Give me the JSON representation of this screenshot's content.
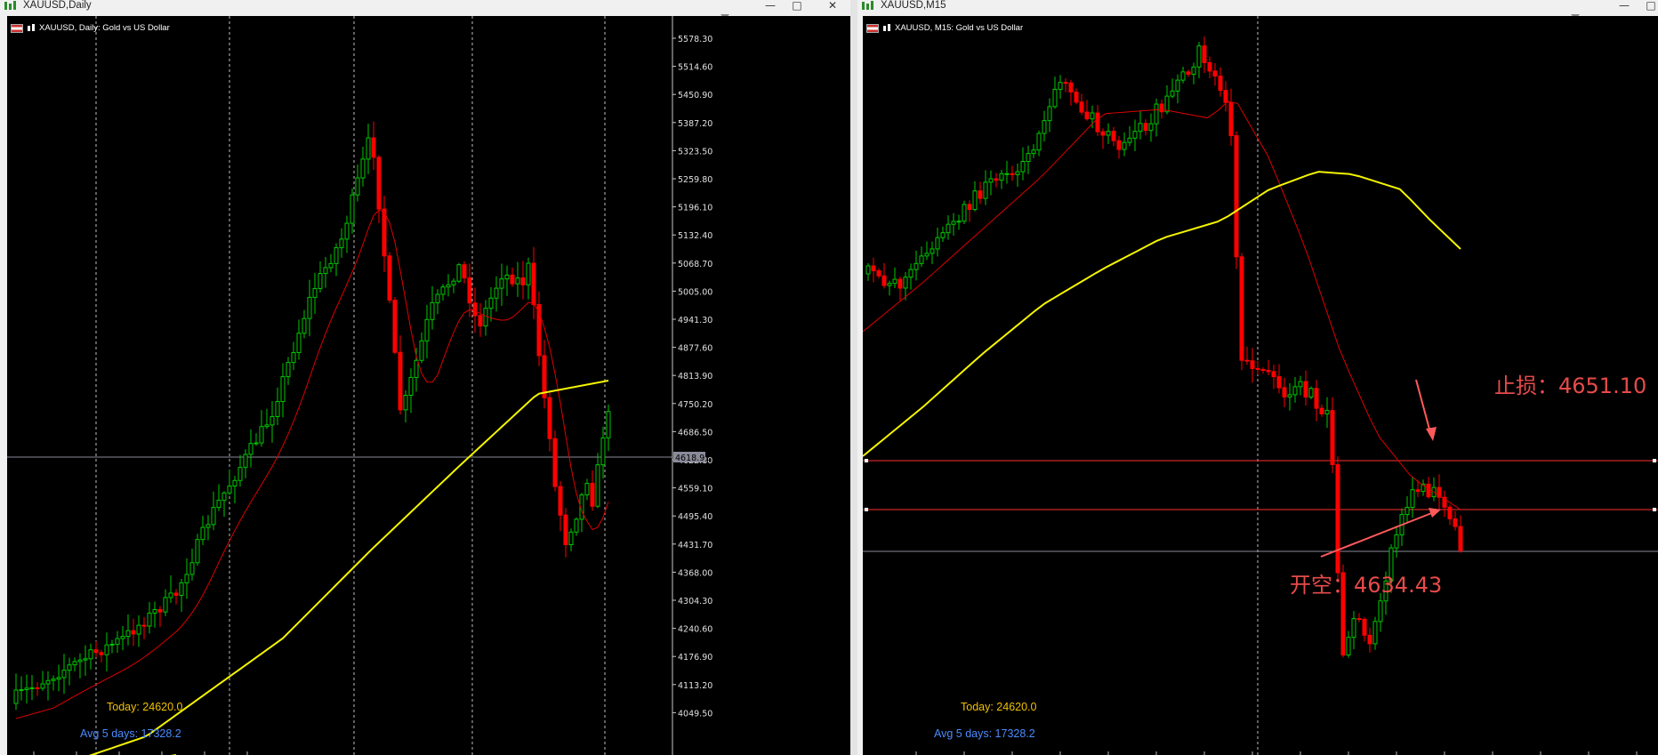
{
  "left_window": {
    "title": "XAUUSD,Daily",
    "symbol_label": "XAUUSD, Daily:  Gold vs US Dollar",
    "today_label": "Today: 24620.0",
    "avg_label": "Avg 5 days: 17328.2",
    "current_price": "4618.91",
    "price_ticks": [
      "5578.30",
      "5514.60",
      "5450.90",
      "5387.20",
      "5323.50",
      "5259.80",
      "5196.10",
      "5132.40",
      "5068.70",
      "5005.00",
      "4941.30",
      "4877.60",
      "4813.90",
      "4750.20",
      "4686.50",
      "4622.80",
      "4559.10",
      "4495.40",
      "4431.70",
      "4368.00",
      "4304.30",
      "4240.60",
      "4176.90",
      "4113.20",
      "4049.50"
    ],
    "colors": {
      "bull": "#00c800",
      "bear": "#ff0000",
      "ma_fast": "#dd0000",
      "ma_slow": "#f5f500",
      "today": "#f0c000",
      "avg": "#4a8cff"
    }
  },
  "right_window": {
    "title": "XAUUSD,M15",
    "symbol_label": "XAUUSD, M15:  Gold vs US Dollar",
    "today_label": "Today: 24620.0",
    "avg_label": "Avg 5 days: 17328.2",
    "stop_loss_label": "止损：4651.10",
    "entry_label": "开空：4634.43"
  },
  "window_buttons": {
    "minimize": "—",
    "maximize": "□",
    "close": "✕"
  },
  "icons": {
    "window_icon": "chart-icon",
    "flag_icon": "flag-icon",
    "candle_icon": "candle-icon"
  }
}
